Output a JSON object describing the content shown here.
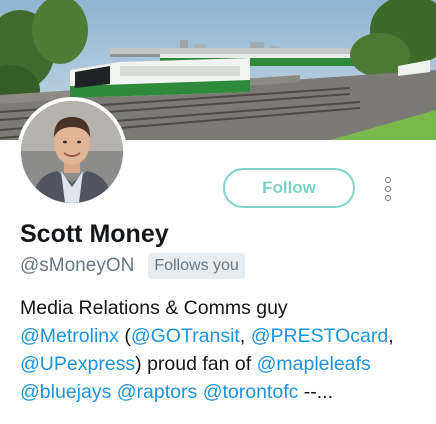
{
  "profile": {
    "name": "Scott Money",
    "handle": "@sMoneyON",
    "follows_you": "Follows you",
    "follow_label": "Follow",
    "bio": {
      "line1": "Media Relations & Comms guy",
      "mention_metrolinx": "@Metrolinx",
      "paren_open": " (",
      "mention_gotransit": "@GOTransit",
      "comma1": ", ",
      "mention_presto": "@PRESTOcard",
      "comma2": ",",
      "mention_upexpress": "@UPexpress",
      "proud_fan": ") proud fan of ",
      "mention_mapleleafs": "@mapleleafs",
      "mention_bluejays": "@bluejays",
      "space1": " ",
      "mention_raptors": "@raptors",
      "space2": " ",
      "mention_torontofc": "@torontofc",
      "ellipsis": " --..."
    }
  },
  "colors": {
    "accent": "#1b95e0",
    "follow_outline": "#7fd3c7",
    "muted": "#657786",
    "badge_bg": "#e6ecf0",
    "text": "#14171a"
  },
  "icons": {
    "more": "vertical-dots-icon"
  }
}
